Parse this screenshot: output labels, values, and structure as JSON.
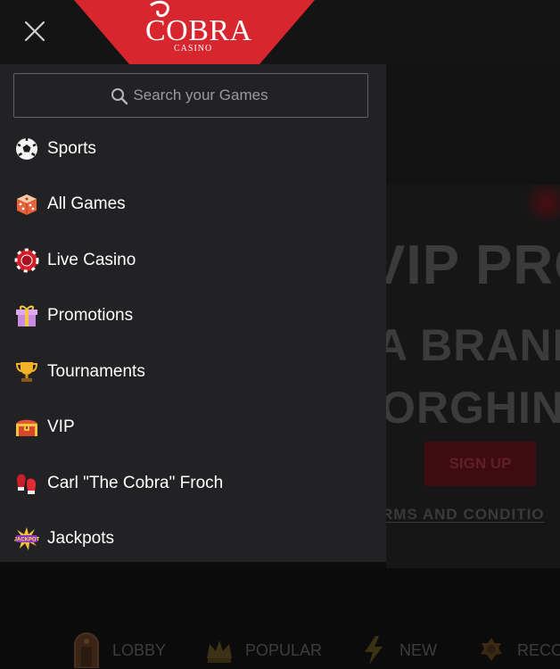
{
  "header": {
    "brand_main": "COBRA",
    "brand_sub": "CASINO",
    "close_icon": "close-icon",
    "colors": {
      "ribbon": "#d7262d"
    }
  },
  "search": {
    "placeholder": "Search your Games",
    "value": "",
    "icon": "search-icon"
  },
  "menu": {
    "items": [
      {
        "label": "Sports",
        "icon": "soccer-ball-icon"
      },
      {
        "label": "All Games",
        "icon": "dice-icon"
      },
      {
        "label": "Live Casino",
        "icon": "casino-chip-icon"
      },
      {
        "label": "Promotions",
        "icon": "gift-box-icon"
      },
      {
        "label": "Tournaments",
        "icon": "trophy-icon"
      },
      {
        "label": "VIP",
        "icon": "treasure-chest-icon"
      },
      {
        "label": "Carl \"The Cobra\" Froch",
        "icon": "boxing-gloves-icon"
      },
      {
        "label": "Jackpots",
        "icon": "jackpot-burst-icon"
      }
    ]
  },
  "hero": {
    "line1": "VIP PRO",
    "line2": "A BRAND",
    "line3": "ORGHIN",
    "signup_label": "SIGN UP",
    "terms_label": "RMS AND CONDITIO"
  },
  "bottom_nav": {
    "items": [
      {
        "label": "LOBBY",
        "icon": "lobby-door-icon"
      },
      {
        "label": "POPULAR",
        "icon": "crown-icon"
      },
      {
        "label": "NEW",
        "icon": "lightning-icon"
      },
      {
        "label": "RECO",
        "icon": "medal-icon"
      }
    ]
  }
}
